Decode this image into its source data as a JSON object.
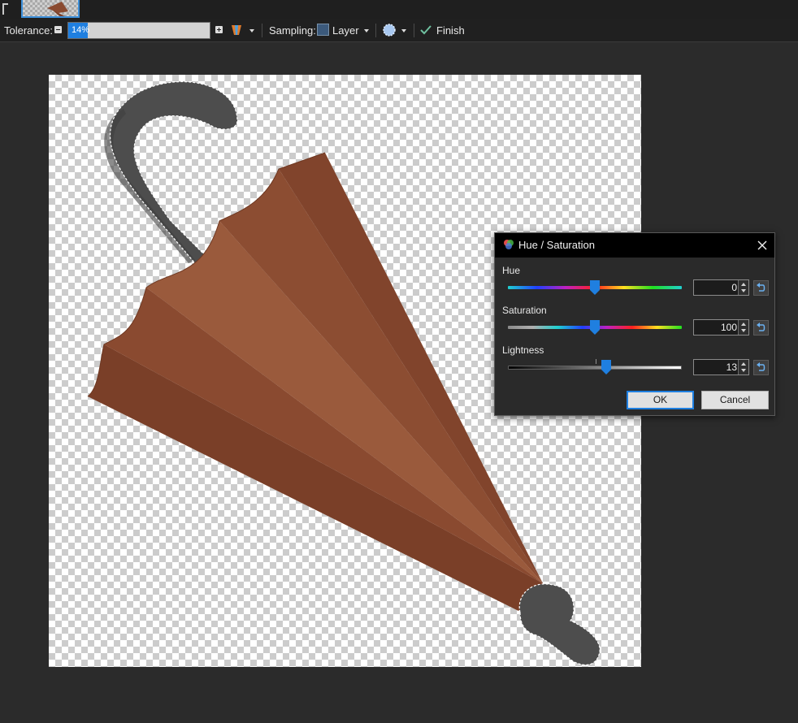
{
  "toolbar": {
    "tolerance_label": "Tolerance:",
    "tolerance_value": "14%",
    "tolerance_fraction": 0.14,
    "sampling_label": "Sampling:",
    "sampling_value": "Layer",
    "finish_label": "Finish",
    "icons": [
      "minus-icon",
      "plus-icon",
      "fill-mode-icon",
      "layer-swatch",
      "antialias-icon",
      "checkmark-icon"
    ]
  },
  "dialog": {
    "title": "Hue / Saturation",
    "close_icon": "close-icon",
    "hue": {
      "label": "Hue",
      "value": "0",
      "level": 0.5
    },
    "saturation": {
      "label": "Saturation",
      "value": "100",
      "level": 0.5
    },
    "lightness": {
      "label": "Lightness",
      "value": "13",
      "level": 0.565
    },
    "ok_label": "OK",
    "cancel_label": "Cancel"
  },
  "colors": {
    "accent": "#1f7fe0",
    "umbrella_dark": "#7a3f28",
    "umbrella_mid": "#8a4a30",
    "umbrella_light": "#9a5a3c",
    "handle": "#4d4d4d"
  }
}
